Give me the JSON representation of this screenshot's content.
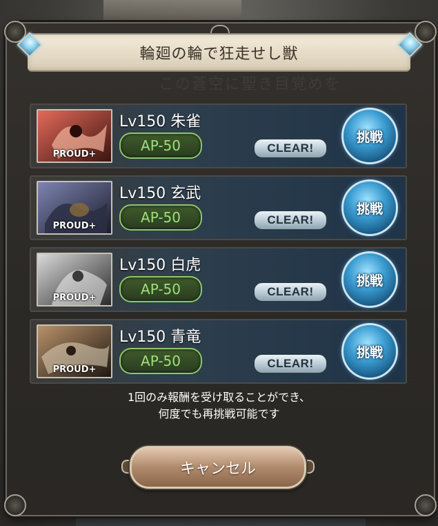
{
  "dialog": {
    "title": "輪廻の輪で狂走せし獣",
    "ghost_text": "この蒼空に聖き目覚めを",
    "quests": [
      {
        "name": "Lv150 朱雀",
        "badge": "PROUD+",
        "ap": "AP-50",
        "status": "CLEAR!",
        "challenge": "挑戦",
        "accent": "#c9463a"
      },
      {
        "name": "Lv150 玄武",
        "badge": "PROUD+",
        "ap": "AP-50",
        "status": "CLEAR!",
        "challenge": "挑戦",
        "accent": "#5a5f8c"
      },
      {
        "name": "Lv150 白虎",
        "badge": "PROUD+",
        "ap": "AP-50",
        "status": "CLEAR!",
        "challenge": "挑戦",
        "accent": "#a9a9a9"
      },
      {
        "name": "Lv150 青竜",
        "badge": "PROUD+",
        "ap": "AP-50",
        "status": "CLEAR!",
        "challenge": "挑戦",
        "accent": "#8c6a4a"
      }
    ],
    "notice_line1": "1回のみ報酬を受け取ることができ、",
    "notice_line2": "何度でも再挑戦可能です",
    "cancel_label": "キャンセル"
  },
  "colors": {
    "ap_green": "#9fe07b",
    "challenge_blue": "#3a9bd0",
    "title_bg": "#e6dcc8"
  },
  "icons": [
    "diamond-gem-icon",
    "diamond-gem-icon"
  ]
}
